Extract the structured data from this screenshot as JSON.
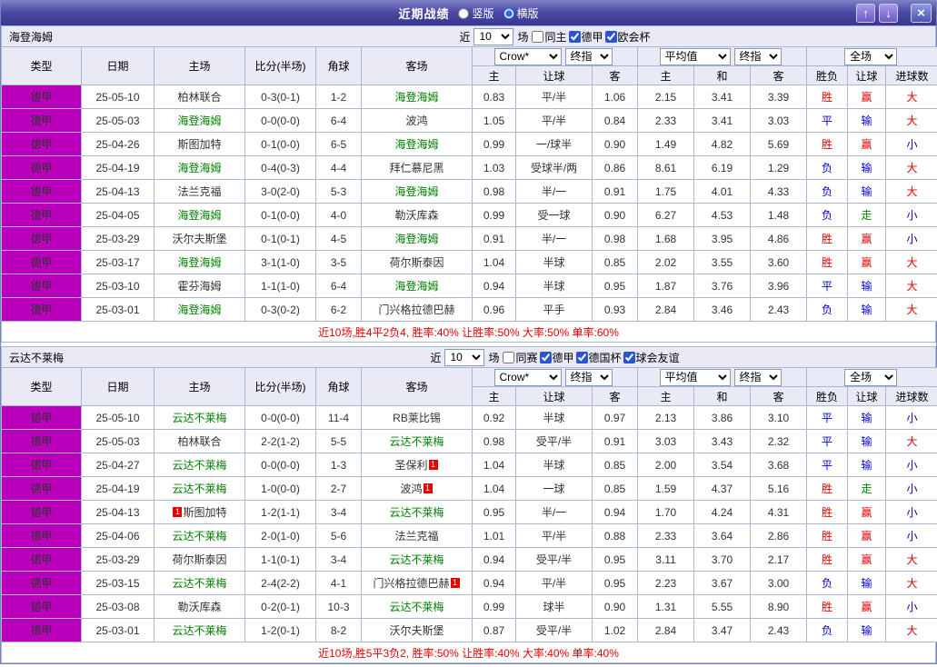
{
  "titlebar": {
    "title": "近期战绩",
    "vertical_label": "竖版",
    "horizontal_label": "横版",
    "selected_layout": "横版",
    "up_icon": "↑",
    "down_icon": "↓",
    "close_icon": "×"
  },
  "table_headers": {
    "type": "类型",
    "date": "日期",
    "home": "主场",
    "score": "比分(半场)",
    "corner": "角球",
    "away": "客场",
    "odds_home": "主",
    "odds_line": "让球",
    "odds_away": "客",
    "avg_home": "主",
    "avg_draw": "和",
    "avg_away": "客",
    "result": "胜负",
    "handicap": "让球",
    "goals": "进球数",
    "bookmaker_select": "Crow*",
    "final_select_1": "终指",
    "average_select": "平均值",
    "final_select_2": "终指",
    "scope_select": "全场"
  },
  "value_colors": {
    "胜": "#e60000",
    "平": "#0000cc",
    "负": "#0000cc",
    "赢": "#e60000",
    "输": "#0000cc",
    "走": "#008800",
    "大": "#e60000",
    "小": "#0000cc"
  },
  "sections": [
    {
      "team": "海登海姆",
      "filter": {
        "near_label": "近",
        "games_value": "10",
        "games_label": "场",
        "options": [
          {
            "label": "同主",
            "checked": false
          },
          {
            "label": "德甲",
            "checked": true
          },
          {
            "label": "欧会杯",
            "checked": true
          }
        ]
      },
      "rows": [
        {
          "league": "德甲",
          "date": "25-05-10",
          "home": {
            "name": "柏林联合"
          },
          "score": "0-3(0-1)",
          "corner": "1-2",
          "away": {
            "name": "海登海姆",
            "self": true
          },
          "odds": [
            "0.83",
            "平/半",
            "1.06"
          ],
          "avg": [
            "2.15",
            "3.41",
            "3.39"
          ],
          "result": "胜",
          "handicap": "赢",
          "goals": "大"
        },
        {
          "league": "德甲",
          "date": "25-05-03",
          "home": {
            "name": "海登海姆",
            "self": true
          },
          "score": "0-0(0-0)",
          "corner": "6-4",
          "away": {
            "name": "波鸿"
          },
          "odds": [
            "1.05",
            "平/半",
            "0.84"
          ],
          "avg": [
            "2.33",
            "3.41",
            "3.03"
          ],
          "result": "平",
          "handicap": "输",
          "goals": "大"
        },
        {
          "league": "德甲",
          "date": "25-04-26",
          "home": {
            "name": "斯图加特"
          },
          "score": "0-1(0-0)",
          "corner": "6-5",
          "away": {
            "name": "海登海姆",
            "self": true
          },
          "odds": [
            "0.99",
            "一/球半",
            "0.90"
          ],
          "avg": [
            "1.49",
            "4.82",
            "5.69"
          ],
          "result": "胜",
          "handicap": "赢",
          "goals": "小"
        },
        {
          "league": "德甲",
          "date": "25-04-19",
          "home": {
            "name": "海登海姆",
            "self": true
          },
          "score": "0-4(0-3)",
          "corner": "4-4",
          "away": {
            "name": "拜仁慕尼黑"
          },
          "odds": [
            "1.03",
            "受球半/两",
            "0.86"
          ],
          "avg": [
            "8.61",
            "6.19",
            "1.29"
          ],
          "result": "负",
          "handicap": "输",
          "goals": "大"
        },
        {
          "league": "德甲",
          "date": "25-04-13",
          "home": {
            "name": "法兰克福"
          },
          "score": "3-0(2-0)",
          "corner": "5-3",
          "away": {
            "name": "海登海姆",
            "self": true
          },
          "odds": [
            "0.98",
            "半/一",
            "0.91"
          ],
          "avg": [
            "1.75",
            "4.01",
            "4.33"
          ],
          "result": "负",
          "handicap": "输",
          "goals": "大"
        },
        {
          "league": "德甲",
          "date": "25-04-05",
          "home": {
            "name": "海登海姆",
            "self": true
          },
          "score": "0-1(0-0)",
          "corner": "4-0",
          "away": {
            "name": "勒沃库森"
          },
          "odds": [
            "0.99",
            "受一球",
            "0.90"
          ],
          "avg": [
            "6.27",
            "4.53",
            "1.48"
          ],
          "result": "负",
          "handicap": "走",
          "goals": "小"
        },
        {
          "league": "德甲",
          "date": "25-03-29",
          "home": {
            "name": "沃尔夫斯堡"
          },
          "score": "0-1(0-1)",
          "corner": "4-5",
          "away": {
            "name": "海登海姆",
            "self": true
          },
          "odds": [
            "0.91",
            "半/一",
            "0.98"
          ],
          "avg": [
            "1.68",
            "3.95",
            "4.86"
          ],
          "result": "胜",
          "handicap": "赢",
          "goals": "小"
        },
        {
          "league": "德甲",
          "date": "25-03-17",
          "home": {
            "name": "海登海姆",
            "self": true
          },
          "score": "3-1(1-0)",
          "corner": "3-5",
          "away": {
            "name": "荷尔斯泰因"
          },
          "odds": [
            "1.04",
            "半球",
            "0.85"
          ],
          "avg": [
            "2.02",
            "3.55",
            "3.60"
          ],
          "result": "胜",
          "handicap": "赢",
          "goals": "大"
        },
        {
          "league": "德甲",
          "date": "25-03-10",
          "home": {
            "name": "霍芬海姆"
          },
          "score": "1-1(1-0)",
          "corner": "6-4",
          "away": {
            "name": "海登海姆",
            "self": true
          },
          "odds": [
            "0.94",
            "半球",
            "0.95"
          ],
          "avg": [
            "1.87",
            "3.76",
            "3.96"
          ],
          "result": "平",
          "handicap": "输",
          "goals": "大"
        },
        {
          "league": "德甲",
          "date": "25-03-01",
          "home": {
            "name": "海登海姆",
            "self": true
          },
          "score": "0-3(0-2)",
          "corner": "6-2",
          "away": {
            "name": "门兴格拉德巴赫"
          },
          "odds": [
            "0.96",
            "平手",
            "0.93"
          ],
          "avg": [
            "2.84",
            "3.46",
            "2.43"
          ],
          "result": "负",
          "handicap": "输",
          "goals": "大"
        }
      ],
      "summary": "近10场,胜4平2负4, 胜率:40% 让胜率:50% 大率:50% 单率:60%"
    },
    {
      "team": "云达不莱梅",
      "filter": {
        "near_label": "近",
        "games_value": "10",
        "games_label": "场",
        "options": [
          {
            "label": "同赛",
            "checked": false
          },
          {
            "label": "德甲",
            "checked": true
          },
          {
            "label": "德国杯",
            "checked": true
          },
          {
            "label": "球会友谊",
            "checked": true
          }
        ]
      },
      "rows": [
        {
          "league": "德甲",
          "date": "25-05-10",
          "home": {
            "name": "云达不莱梅",
            "self": true
          },
          "score": "0-0(0-0)",
          "corner": "11-4",
          "away": {
            "name": "RB莱比锡"
          },
          "odds": [
            "0.92",
            "半球",
            "0.97"
          ],
          "avg": [
            "2.13",
            "3.86",
            "3.10"
          ],
          "result": "平",
          "handicap": "输",
          "goals": "小"
        },
        {
          "league": "德甲",
          "date": "25-05-03",
          "home": {
            "name": "柏林联合"
          },
          "score": "2-2(1-2)",
          "corner": "5-5",
          "away": {
            "name": "云达不莱梅",
            "self": true
          },
          "odds": [
            "0.98",
            "受平/半",
            "0.91"
          ],
          "avg": [
            "3.03",
            "3.43",
            "2.32"
          ],
          "result": "平",
          "handicap": "输",
          "goals": "大"
        },
        {
          "league": "德甲",
          "date": "25-04-27",
          "home": {
            "name": "云达不莱梅",
            "self": true
          },
          "score": "0-0(0-0)",
          "corner": "1-3",
          "away": {
            "name": "圣保利",
            "card_after": "1"
          },
          "odds": [
            "1.04",
            "半球",
            "0.85"
          ],
          "avg": [
            "2.00",
            "3.54",
            "3.68"
          ],
          "result": "平",
          "handicap": "输",
          "goals": "小"
        },
        {
          "league": "德甲",
          "date": "25-04-19",
          "home": {
            "name": "云达不莱梅",
            "self": true
          },
          "score": "1-0(0-0)",
          "corner": "2-7",
          "away": {
            "name": "波鸿",
            "card_after": "1"
          },
          "odds": [
            "1.04",
            "一球",
            "0.85"
          ],
          "avg": [
            "1.59",
            "4.37",
            "5.16"
          ],
          "result": "胜",
          "handicap": "走",
          "goals": "小"
        },
        {
          "league": "德甲",
          "date": "25-04-13",
          "home": {
            "name": "斯图加特",
            "card_before": "1"
          },
          "score": "1-2(1-1)",
          "corner": "3-4",
          "away": {
            "name": "云达不莱梅",
            "self": true
          },
          "odds": [
            "0.95",
            "半/一",
            "0.94"
          ],
          "avg": [
            "1.70",
            "4.24",
            "4.31"
          ],
          "result": "胜",
          "handicap": "赢",
          "goals": "小"
        },
        {
          "league": "德甲",
          "date": "25-04-06",
          "home": {
            "name": "云达不莱梅",
            "self": true
          },
          "score": "2-0(1-0)",
          "corner": "5-6",
          "away": {
            "name": "法兰克福"
          },
          "odds": [
            "1.01",
            "平/半",
            "0.88"
          ],
          "avg": [
            "2.33",
            "3.64",
            "2.86"
          ],
          "result": "胜",
          "handicap": "赢",
          "goals": "小"
        },
        {
          "league": "德甲",
          "date": "25-03-29",
          "home": {
            "name": "荷尔斯泰因"
          },
          "score": "1-1(0-1)",
          "corner": "3-4",
          "away": {
            "name": "云达不莱梅",
            "self": true
          },
          "odds": [
            "0.94",
            "受平/半",
            "0.95"
          ],
          "avg": [
            "3.11",
            "3.70",
            "2.17"
          ],
          "result": "胜",
          "handicap": "赢",
          "goals": "大"
        },
        {
          "league": "德甲",
          "date": "25-03-15",
          "home": {
            "name": "云达不莱梅",
            "self": true
          },
          "score": "2-4(2-2)",
          "corner": "4-1",
          "away": {
            "name": "门兴格拉德巴赫",
            "card_after": "1"
          },
          "odds": [
            "0.94",
            "平/半",
            "0.95"
          ],
          "avg": [
            "2.23",
            "3.67",
            "3.00"
          ],
          "result": "负",
          "handicap": "输",
          "goals": "大"
        },
        {
          "league": "德甲",
          "date": "25-03-08",
          "home": {
            "name": "勒沃库森"
          },
          "score": "0-2(0-1)",
          "corner": "10-3",
          "away": {
            "name": "云达不莱梅",
            "self": true
          },
          "odds": [
            "0.99",
            "球半",
            "0.90"
          ],
          "avg": [
            "1.31",
            "5.55",
            "8.90"
          ],
          "result": "胜",
          "handicap": "赢",
          "goals": "小"
        },
        {
          "league": "德甲",
          "date": "25-03-01",
          "home": {
            "name": "云达不莱梅",
            "self": true
          },
          "score": "1-2(0-1)",
          "corner": "8-2",
          "away": {
            "name": "沃尔夫斯堡"
          },
          "odds": [
            "0.87",
            "受平/半",
            "1.02"
          ],
          "avg": [
            "2.84",
            "3.47",
            "2.43"
          ],
          "result": "负",
          "handicap": "输",
          "goals": "大"
        }
      ],
      "summary": "近10场,胜5平3负2, 胜率:50% 让胜率:40% 大率:40% 单率:40%"
    }
  ]
}
